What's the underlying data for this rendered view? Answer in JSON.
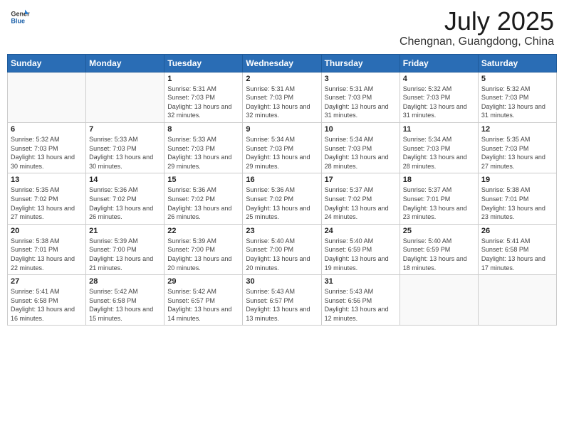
{
  "logo": {
    "line1": "General",
    "line2": "Blue"
  },
  "title": "July 2025",
  "location": "Chengnan, Guangdong, China",
  "days_of_week": [
    "Sunday",
    "Monday",
    "Tuesday",
    "Wednesday",
    "Thursday",
    "Friday",
    "Saturday"
  ],
  "weeks": [
    [
      {
        "day": "",
        "info": ""
      },
      {
        "day": "",
        "info": ""
      },
      {
        "day": "1",
        "info": "Sunrise: 5:31 AM\nSunset: 7:03 PM\nDaylight: 13 hours and 32 minutes."
      },
      {
        "day": "2",
        "info": "Sunrise: 5:31 AM\nSunset: 7:03 PM\nDaylight: 13 hours and 32 minutes."
      },
      {
        "day": "3",
        "info": "Sunrise: 5:31 AM\nSunset: 7:03 PM\nDaylight: 13 hours and 31 minutes."
      },
      {
        "day": "4",
        "info": "Sunrise: 5:32 AM\nSunset: 7:03 PM\nDaylight: 13 hours and 31 minutes."
      },
      {
        "day": "5",
        "info": "Sunrise: 5:32 AM\nSunset: 7:03 PM\nDaylight: 13 hours and 31 minutes."
      }
    ],
    [
      {
        "day": "6",
        "info": "Sunrise: 5:32 AM\nSunset: 7:03 PM\nDaylight: 13 hours and 30 minutes."
      },
      {
        "day": "7",
        "info": "Sunrise: 5:33 AM\nSunset: 7:03 PM\nDaylight: 13 hours and 30 minutes."
      },
      {
        "day": "8",
        "info": "Sunrise: 5:33 AM\nSunset: 7:03 PM\nDaylight: 13 hours and 29 minutes."
      },
      {
        "day": "9",
        "info": "Sunrise: 5:34 AM\nSunset: 7:03 PM\nDaylight: 13 hours and 29 minutes."
      },
      {
        "day": "10",
        "info": "Sunrise: 5:34 AM\nSunset: 7:03 PM\nDaylight: 13 hours and 28 minutes."
      },
      {
        "day": "11",
        "info": "Sunrise: 5:34 AM\nSunset: 7:03 PM\nDaylight: 13 hours and 28 minutes."
      },
      {
        "day": "12",
        "info": "Sunrise: 5:35 AM\nSunset: 7:03 PM\nDaylight: 13 hours and 27 minutes."
      }
    ],
    [
      {
        "day": "13",
        "info": "Sunrise: 5:35 AM\nSunset: 7:02 PM\nDaylight: 13 hours and 27 minutes."
      },
      {
        "day": "14",
        "info": "Sunrise: 5:36 AM\nSunset: 7:02 PM\nDaylight: 13 hours and 26 minutes."
      },
      {
        "day": "15",
        "info": "Sunrise: 5:36 AM\nSunset: 7:02 PM\nDaylight: 13 hours and 26 minutes."
      },
      {
        "day": "16",
        "info": "Sunrise: 5:36 AM\nSunset: 7:02 PM\nDaylight: 13 hours and 25 minutes."
      },
      {
        "day": "17",
        "info": "Sunrise: 5:37 AM\nSunset: 7:02 PM\nDaylight: 13 hours and 24 minutes."
      },
      {
        "day": "18",
        "info": "Sunrise: 5:37 AM\nSunset: 7:01 PM\nDaylight: 13 hours and 23 minutes."
      },
      {
        "day": "19",
        "info": "Sunrise: 5:38 AM\nSunset: 7:01 PM\nDaylight: 13 hours and 23 minutes."
      }
    ],
    [
      {
        "day": "20",
        "info": "Sunrise: 5:38 AM\nSunset: 7:01 PM\nDaylight: 13 hours and 22 minutes."
      },
      {
        "day": "21",
        "info": "Sunrise: 5:39 AM\nSunset: 7:00 PM\nDaylight: 13 hours and 21 minutes."
      },
      {
        "day": "22",
        "info": "Sunrise: 5:39 AM\nSunset: 7:00 PM\nDaylight: 13 hours and 20 minutes."
      },
      {
        "day": "23",
        "info": "Sunrise: 5:40 AM\nSunset: 7:00 PM\nDaylight: 13 hours and 20 minutes."
      },
      {
        "day": "24",
        "info": "Sunrise: 5:40 AM\nSunset: 6:59 PM\nDaylight: 13 hours and 19 minutes."
      },
      {
        "day": "25",
        "info": "Sunrise: 5:40 AM\nSunset: 6:59 PM\nDaylight: 13 hours and 18 minutes."
      },
      {
        "day": "26",
        "info": "Sunrise: 5:41 AM\nSunset: 6:58 PM\nDaylight: 13 hours and 17 minutes."
      }
    ],
    [
      {
        "day": "27",
        "info": "Sunrise: 5:41 AM\nSunset: 6:58 PM\nDaylight: 13 hours and 16 minutes."
      },
      {
        "day": "28",
        "info": "Sunrise: 5:42 AM\nSunset: 6:58 PM\nDaylight: 13 hours and 15 minutes."
      },
      {
        "day": "29",
        "info": "Sunrise: 5:42 AM\nSunset: 6:57 PM\nDaylight: 13 hours and 14 minutes."
      },
      {
        "day": "30",
        "info": "Sunrise: 5:43 AM\nSunset: 6:57 PM\nDaylight: 13 hours and 13 minutes."
      },
      {
        "day": "31",
        "info": "Sunrise: 5:43 AM\nSunset: 6:56 PM\nDaylight: 13 hours and 12 minutes."
      },
      {
        "day": "",
        "info": ""
      },
      {
        "day": "",
        "info": ""
      }
    ]
  ]
}
